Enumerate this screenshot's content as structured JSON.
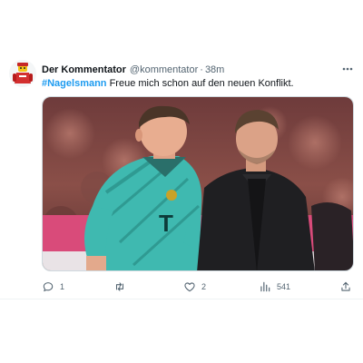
{
  "tweet": {
    "author_name": "Der Kommentator",
    "handle": "@kommentator",
    "separator": "·",
    "time": "38m",
    "hashtag": "#Nagelsmann",
    "text": " Freue mich schon auf den neuen Konflikt.",
    "more_icon": "more-horizontal-icon",
    "media": {
      "description_icon": "photo-image",
      "shirt_sponsor": "T",
      "crest_color": "#c9a227"
    },
    "actions": {
      "reply_count": "1",
      "retweet_count": "",
      "like_count": "2",
      "view_count": "541"
    }
  },
  "colors": {
    "accent": "#1d9bf0",
    "muted": "#536471",
    "jersey": "#3fb9b0"
  }
}
